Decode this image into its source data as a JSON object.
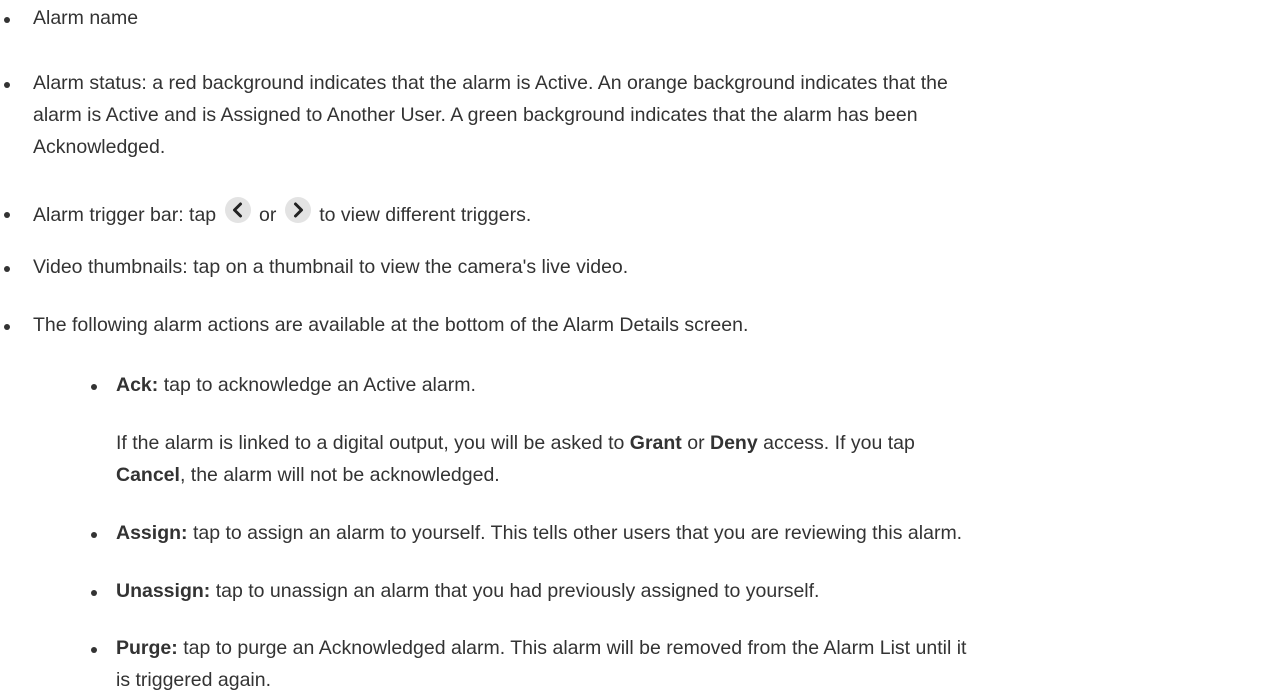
{
  "bullets": {
    "alarm_name": "Alarm name",
    "alarm_status_1": "Alarm status: a red background indicates that the alarm is Active. An orange background indicates that the",
    "alarm_status_2": "alarm is Active and is Assigned to Another User. A green background indicates that the alarm has been",
    "alarm_status_3": "Acknowledged.",
    "trigger_bar_prefix": "Alarm trigger bar: tap",
    "trigger_bar_or": "or",
    "trigger_bar_suffix": "to view different triggers.",
    "video_thumbnails": "Video thumbnails: tap on a thumbnail to view the camera's live video.",
    "actions_intro": "The following alarm actions are available at the bottom of the Alarm Details screen."
  },
  "actions": {
    "ack_label": "Ack:",
    "ack_text": "tap to acknowledge an Active alarm.",
    "ack_note_1": "If the alarm is linked to a digital output, you will be asked to",
    "ack_note_grant": "Grant",
    "ack_note_or": "or",
    "ack_note_deny": "Deny",
    "ack_note_2": "access. If you tap",
    "ack_note_cancel": "Cancel",
    "ack_note_3": ", the alarm will not be acknowledged.",
    "assign_label": "Assign:",
    "assign_text": "tap to assign an alarm to yourself. This tells other users that you are reviewing this alarm.",
    "unassign_label": "Unassign:",
    "unassign_text": "tap to unassign an alarm that you had previously assigned to yourself.",
    "purge_label": "Purge:",
    "purge_text_1": "tap to purge an Acknowledged alarm. This alarm will be removed from the Alarm List until it",
    "purge_text_2": "is triggered again."
  },
  "icons": {
    "prev": "chevron-left-icon",
    "next": "chevron-right-icon"
  },
  "colors": {
    "text": "#333333",
    "icon_bg": "#e3e3e3",
    "icon_fg": "#222222"
  }
}
